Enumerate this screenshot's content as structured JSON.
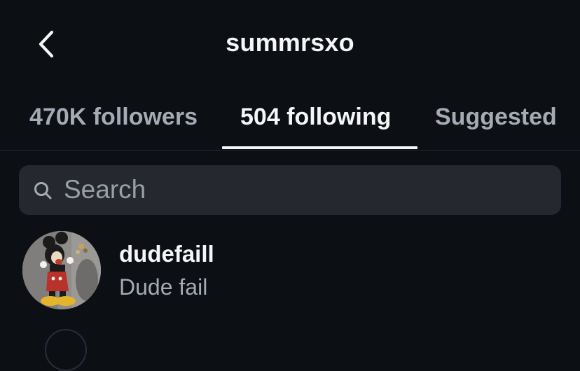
{
  "header": {
    "back_icon": "chevron-left-icon",
    "title": "summrsxo"
  },
  "tabs": [
    {
      "label": "470K followers",
      "active": false
    },
    {
      "label": "504 following",
      "active": true
    },
    {
      "label": "Suggested",
      "active": false
    }
  ],
  "search": {
    "icon": "search-icon",
    "placeholder": "Search",
    "value": ""
  },
  "list": [
    {
      "username": "dudefaill",
      "full_name": "Dude fail",
      "avatar": "mickey-mouse-photo"
    }
  ],
  "colors": {
    "background": "#0c0f14",
    "text_primary": "#f5f6f8",
    "text_secondary": "#a6aab2",
    "search_bg": "#25282e"
  }
}
